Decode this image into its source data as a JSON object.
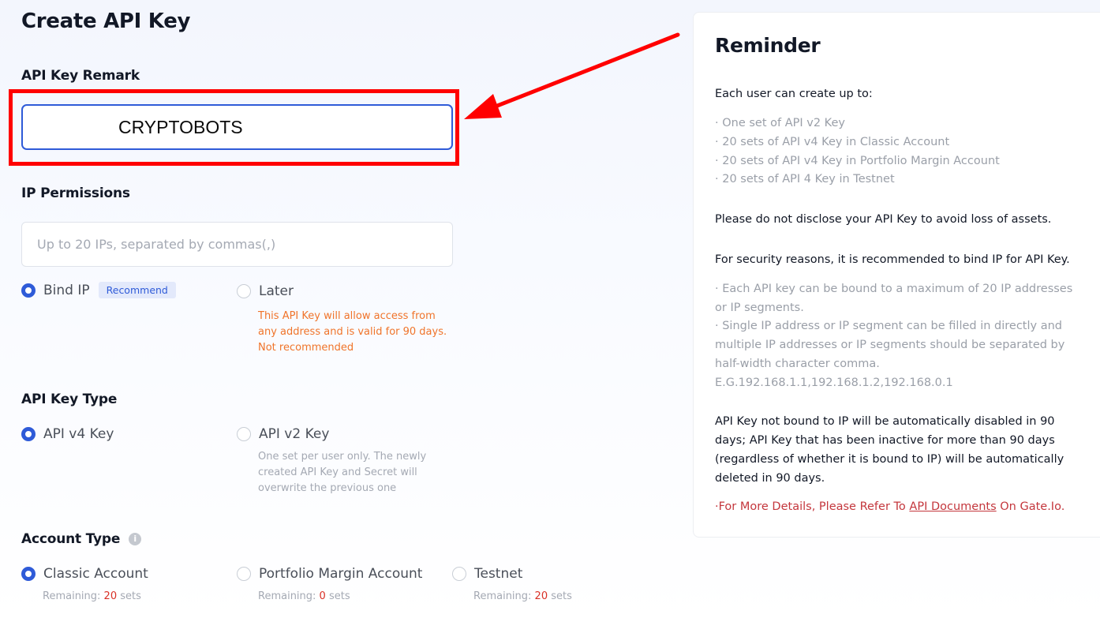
{
  "page": {
    "title": "Create API Key"
  },
  "remark": {
    "label": "API Key Remark",
    "value": "CRYPTOBOTS"
  },
  "ip": {
    "label": "IP Permissions",
    "placeholder": "Up to 20 IPs, separated by commas(,)",
    "options": {
      "bind": {
        "label": "Bind IP",
        "badge": "Recommend",
        "selected": true
      },
      "later": {
        "label": "Later",
        "note": "This API Key will allow access from any address and is valid for 90 days. Not recommended",
        "selected": false
      }
    }
  },
  "key_type": {
    "label": "API Key Type",
    "v4": {
      "label": "API v4 Key",
      "selected": true
    },
    "v2": {
      "label": "API v2 Key",
      "note": "One set per user only. The newly created API Key and Secret will overwrite the previous one",
      "selected": false
    }
  },
  "account": {
    "label": "Account Type",
    "classic": {
      "label": "Classic Account",
      "remain_prefix": "Remaining: ",
      "remain_count": "20",
      "remain_suffix": " sets",
      "selected": true
    },
    "portfolio": {
      "label": "Portfolio Margin Account",
      "remain_prefix": "Remaining: ",
      "remain_count": "0",
      "remain_suffix": " sets",
      "selected": false
    },
    "testnet": {
      "label": "Testnet",
      "remain_prefix": "Remaining: ",
      "remain_count": "20",
      "remain_suffix": " sets",
      "selected": false
    }
  },
  "reminder": {
    "title": "Reminder",
    "intro": "Each user can create up to:",
    "limits": [
      "· One set of API v2 Key",
      "· 20 sets of API v4 Key in Classic Account",
      "· 20 sets of API v4 Key in Portfolio Margin Account",
      "· 20 sets of API 4 Key in Testnet"
    ],
    "disclose": "Please do not disclose your API Key to avoid loss of assets.",
    "security": "For security reasons, it is recommended to bind IP for API Key.",
    "ip_rules": "· Each API key can be bound to a maximum of 20 IP addresses or IP segments.",
    "ip_format": "· Single IP address or IP segment can be filled in directly and multiple IP addresses or IP segments should be separated by half-width character comma. E.G.192.168.1.1,192.168.1.2,192.168.0.1",
    "expiry": "API Key not bound to IP will be automatically disabled in 90 days; API Key that has been inactive for more than 90 days (regardless of whether it is bound to IP) will be automatically deleted in 90 days.",
    "more_prefix": "·For More Details, Please Refer To ",
    "more_link": "API Documents",
    "more_suffix": " On Gate.Io."
  },
  "colors": {
    "accent": "#2f5bd8",
    "annotation": "#ff0000",
    "warning": "#f0742a",
    "link": "#c4373d"
  },
  "icons": {
    "annotation_arrow": "arrow-icon",
    "info": "info-icon"
  }
}
